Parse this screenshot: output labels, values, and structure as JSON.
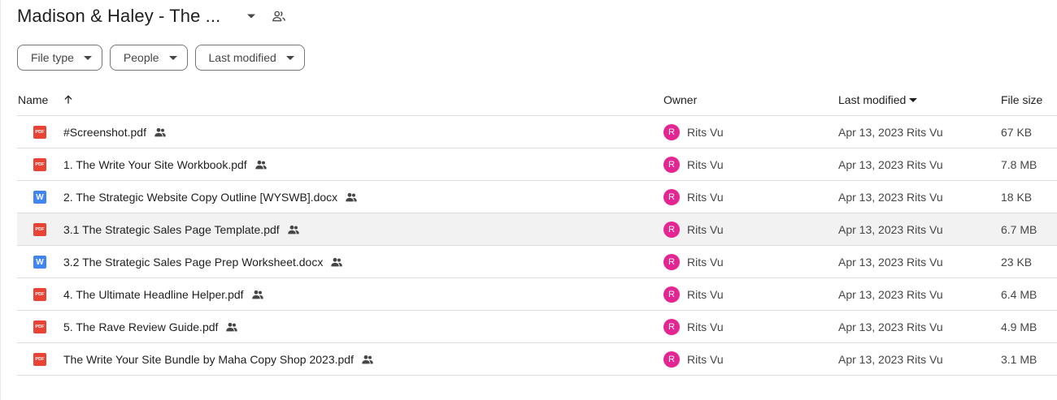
{
  "folder": {
    "title": "Madison & Haley - The ..."
  },
  "filters": [
    {
      "label": "File type"
    },
    {
      "label": "People"
    },
    {
      "label": "Last modified"
    }
  ],
  "columns": {
    "name": "Name",
    "owner": "Owner",
    "last_modified": "Last modified",
    "file_size": "File size"
  },
  "sort": {
    "column": "name",
    "direction": "ascending"
  },
  "files": [
    {
      "type": "pdf",
      "icon_label": "PDF",
      "name": "#Screenshot.pdf",
      "owner": "Rits Vu",
      "owner_initial": "R",
      "modified": "Apr 13, 2023 Rits Vu",
      "size": "67 KB",
      "shared": true,
      "selected": false
    },
    {
      "type": "pdf",
      "icon_label": "PDF",
      "name": "1. The Write Your Site Workbook.pdf",
      "owner": "Rits Vu",
      "owner_initial": "R",
      "modified": "Apr 13, 2023 Rits Vu",
      "size": "7.8 MB",
      "shared": true,
      "selected": false
    },
    {
      "type": "docx",
      "icon_label": "W",
      "name": "2. The Strategic Website Copy Outline [WYSWB].docx",
      "owner": "Rits Vu",
      "owner_initial": "R",
      "modified": "Apr 13, 2023 Rits Vu",
      "size": "18 KB",
      "shared": true,
      "selected": false
    },
    {
      "type": "pdf",
      "icon_label": "PDF",
      "name": "3.1 The Strategic Sales Page Template.pdf",
      "owner": "Rits Vu",
      "owner_initial": "R",
      "modified": "Apr 13, 2023 Rits Vu",
      "size": "6.7 MB",
      "shared": true,
      "selected": true
    },
    {
      "type": "docx",
      "icon_label": "W",
      "name": "3.2 The Strategic Sales Page Prep Worksheet.docx",
      "owner": "Rits Vu",
      "owner_initial": "R",
      "modified": "Apr 13, 2023 Rits Vu",
      "size": "23 KB",
      "shared": true,
      "selected": false
    },
    {
      "type": "pdf",
      "icon_label": "PDF",
      "name": "4. The Ultimate Headline Helper.pdf",
      "owner": "Rits Vu",
      "owner_initial": "R",
      "modified": "Apr 13, 2023 Rits Vu",
      "size": "6.4 MB",
      "shared": true,
      "selected": false
    },
    {
      "type": "pdf",
      "icon_label": "PDF",
      "name": "5. The Rave Review Guide.pdf",
      "owner": "Rits Vu",
      "owner_initial": "R",
      "modified": "Apr 13, 2023 Rits Vu",
      "size": "4.9 MB",
      "shared": true,
      "selected": false
    },
    {
      "type": "pdf",
      "icon_label": "PDF",
      "name": "The Write Your Site Bundle by Maha Copy Shop 2023.pdf",
      "owner": "Rits Vu",
      "owner_initial": "R",
      "modified": "Apr 13, 2023 Rits Vu",
      "size": "3.1 MB",
      "shared": true,
      "selected": false
    }
  ],
  "colors": {
    "pdf_icon": "#ea4335",
    "doc_icon": "#4285f4",
    "avatar": "#e52592",
    "selected_row": "#f2f2f2"
  }
}
